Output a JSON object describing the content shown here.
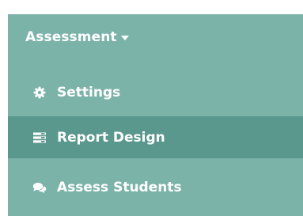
{
  "menu": {
    "title": "Assessment",
    "items": [
      {
        "label": "Settings",
        "icon": "gear-icon",
        "active": false
      },
      {
        "label": "Report Design",
        "icon": "report-list-icon",
        "active": true
      },
      {
        "label": "Assess Students",
        "icon": "chat-bubbles-icon",
        "active": false
      }
    ]
  },
  "colors": {
    "panel_bg": "#7bb3a9",
    "active_bg": "#5a978d",
    "text": "#ffffff"
  }
}
